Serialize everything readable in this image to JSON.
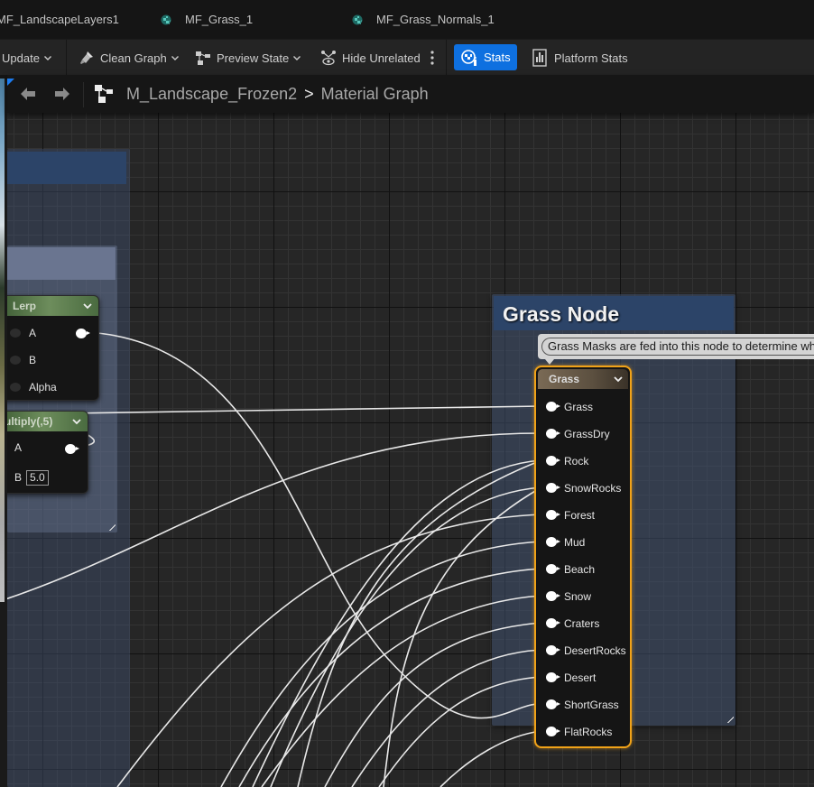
{
  "tabs": [
    {
      "label": "MF_LandscapeLayers1",
      "icon": "material-function-icon"
    },
    {
      "label": "MF_Grass_1",
      "icon": "material-function-icon"
    },
    {
      "label": "MF_Grass_Normals_1",
      "icon": "material-function-icon"
    }
  ],
  "toolbar": {
    "update_label": "Update",
    "clean_graph_label": "Clean Graph",
    "preview_state_label": "Preview State",
    "hide_unrelated_label": "Hide Unrelated",
    "stats_label": "Stats",
    "platform_stats_label": "Platform Stats"
  },
  "breadcrumb": {
    "material": "M_Landscape_Frozen2",
    "separator": ">",
    "graph": "Material Graph"
  },
  "nodes": {
    "lerp": {
      "title": "Lerp",
      "pins": [
        "A",
        "B",
        "Alpha"
      ]
    },
    "multiply": {
      "title": "ultiply(,5)",
      "pins": [
        "A",
        "B"
      ],
      "b_value": "5.0"
    },
    "grass": {
      "comment_title": "Grass Node",
      "tooltip": "Grass Masks are fed into this node to determine where grass is placed",
      "title": "Grass",
      "pins": [
        "Grass",
        "GrassDry",
        "Rock",
        "SnowRocks",
        "Forest",
        "Mud",
        "Beach",
        "Snow",
        "Craters",
        "DesertRocks",
        "Desert",
        "ShortGrass",
        "FlatRocks"
      ]
    }
  },
  "colors": {
    "accent_blue": "#0e70e0",
    "selection_orange": "#f0a218",
    "comment_blue": "#2c4468",
    "graph_bg": "#262626"
  }
}
